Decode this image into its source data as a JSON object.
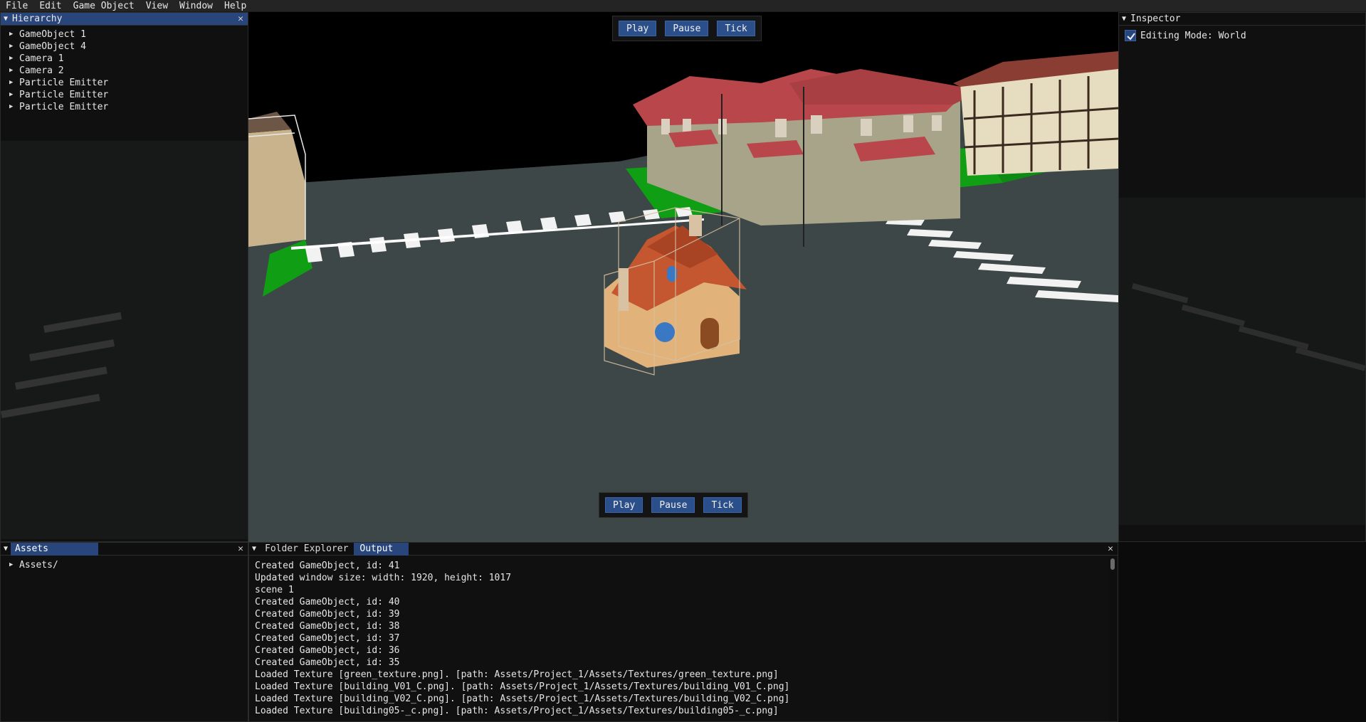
{
  "menu": [
    "File",
    "Edit",
    "Game Object",
    "View",
    "Window",
    "Help"
  ],
  "hierarchy": {
    "title": "Hierarchy",
    "items": [
      "GameObject 1",
      "GameObject 4",
      "Camera 1",
      "Camera 2",
      "Particle Emitter",
      "Particle Emitter",
      "Particle Emitter"
    ]
  },
  "viewport": {
    "top_controls": [
      "Play",
      "Pause",
      "Tick"
    ],
    "bottom_controls": [
      "Play",
      "Pause",
      "Tick"
    ]
  },
  "inspector": {
    "title": "Inspector",
    "editing_mode_label": "Editing Mode: World",
    "editing_mode_checked": true
  },
  "assets": {
    "title": "Assets",
    "root": "Assets/"
  },
  "output": {
    "tabs": [
      "Folder Explorer",
      "Output"
    ],
    "selected_tab": "Output",
    "lines": [
      "Created GameObject, id: 41",
      "Updated window size: width: 1920, height: 1017",
      "scene 1",
      "Created GameObject, id: 40",
      "Created GameObject, id: 39",
      "Created GameObject, id: 38",
      "Created GameObject, id: 37",
      "Created GameObject, id: 36",
      "Created GameObject, id: 35",
      "Loaded Texture [green_texture.png]. [path: Assets/Project_1/Assets/Textures/green_texture.png]",
      "Loaded Texture [building_V01_C.png]. [path: Assets/Project_1/Assets/Textures/building_V01_C.png]",
      "Loaded Texture [building_V02_C.png]. [path: Assets/Project_1/Assets/Textures/building_V02_C.png]",
      "Loaded Texture [building05-_c.png]. [path: Assets/Project_1/Assets/Textures/building05-_c.png]"
    ]
  },
  "colors": {
    "accent": "#28467b",
    "button": "#2b4f8a",
    "road": "#3a4444",
    "grass": "#0f9e14",
    "roof": "#b9464a"
  }
}
